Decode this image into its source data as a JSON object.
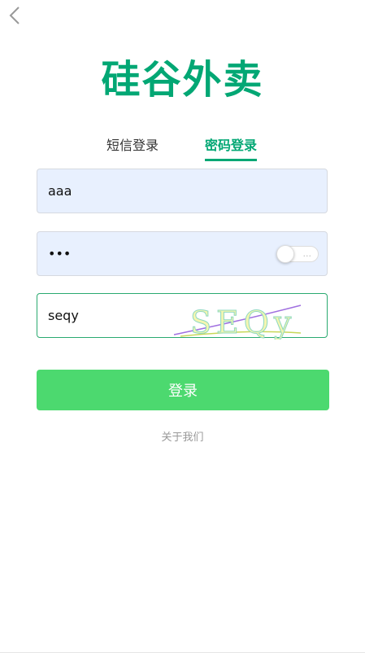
{
  "app": {
    "title": "硅谷外卖"
  },
  "tabs": [
    {
      "label": "短信登录",
      "active": false
    },
    {
      "label": "密码登录",
      "active": true
    }
  ],
  "form": {
    "username_value": "aaa",
    "password_value": "•••",
    "password_toggle_text": "...",
    "captcha_value": "seqy",
    "captcha_image_text": "SEQy"
  },
  "buttons": {
    "login_label": "登录"
  },
  "links": {
    "about_label": "关于我们"
  },
  "colors": {
    "brand": "#02a774",
    "login_button": "#4cd96f",
    "autofill_bg": "#e8f0fe"
  },
  "icons": {
    "back": "chevron-left-icon",
    "toggle": "toggle-switch-icon"
  }
}
